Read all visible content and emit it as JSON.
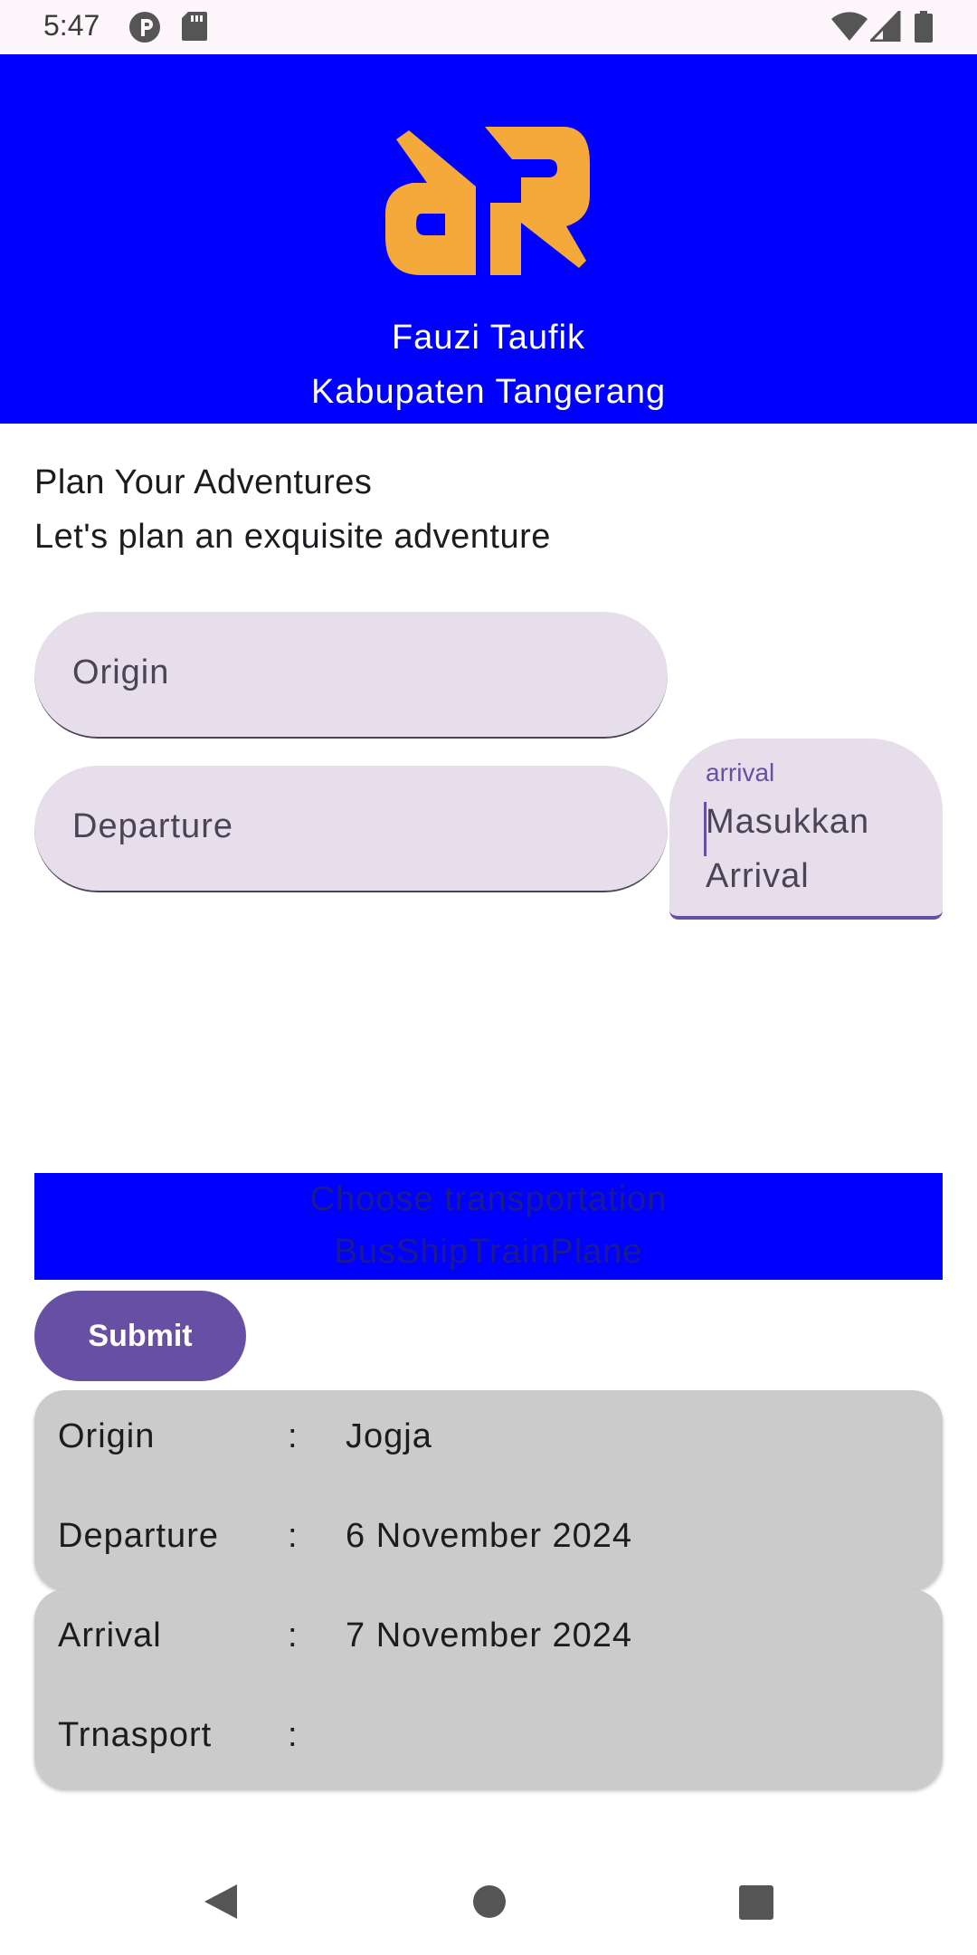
{
  "status_bar": {
    "time": "5:47",
    "icons": [
      "notification-app-icon",
      "sd-card-icon",
      "wifi-icon",
      "signal-icon",
      "battery-icon"
    ]
  },
  "header": {
    "name": "Fauzi Taufik",
    "city": "Kabupaten Tangerang",
    "background_color": "#0000ff",
    "logo_color": "#f4a93a"
  },
  "intro": {
    "title": "Plan Your Adventures",
    "subtitle": "Let's plan an exquisite adventure"
  },
  "form": {
    "origin_placeholder": "Origin",
    "departure_placeholder": "Departure",
    "arrival_label": "arrival",
    "arrival_value": "Masukkan Arrival"
  },
  "transport": {
    "title": "Choose transportation",
    "options_text": "BusShipTrainPlane"
  },
  "submit": {
    "label": "Submit",
    "color": "#6750a4"
  },
  "summary": {
    "cards": [
      {
        "rows": [
          {
            "label": "Origin",
            "colon": ":",
            "value": "Jogja"
          },
          {
            "label": "Departure",
            "colon": ":",
            "value": "6 November 2024"
          }
        ]
      },
      {
        "rows": [
          {
            "label": "Arrival",
            "colon": ":",
            "value": "7 November 2024"
          },
          {
            "label": "Trnasport",
            "colon": ":",
            "value": ""
          }
        ]
      }
    ]
  },
  "nav_bar": {
    "icons": [
      "back-icon",
      "home-icon",
      "recent-apps-icon"
    ]
  }
}
